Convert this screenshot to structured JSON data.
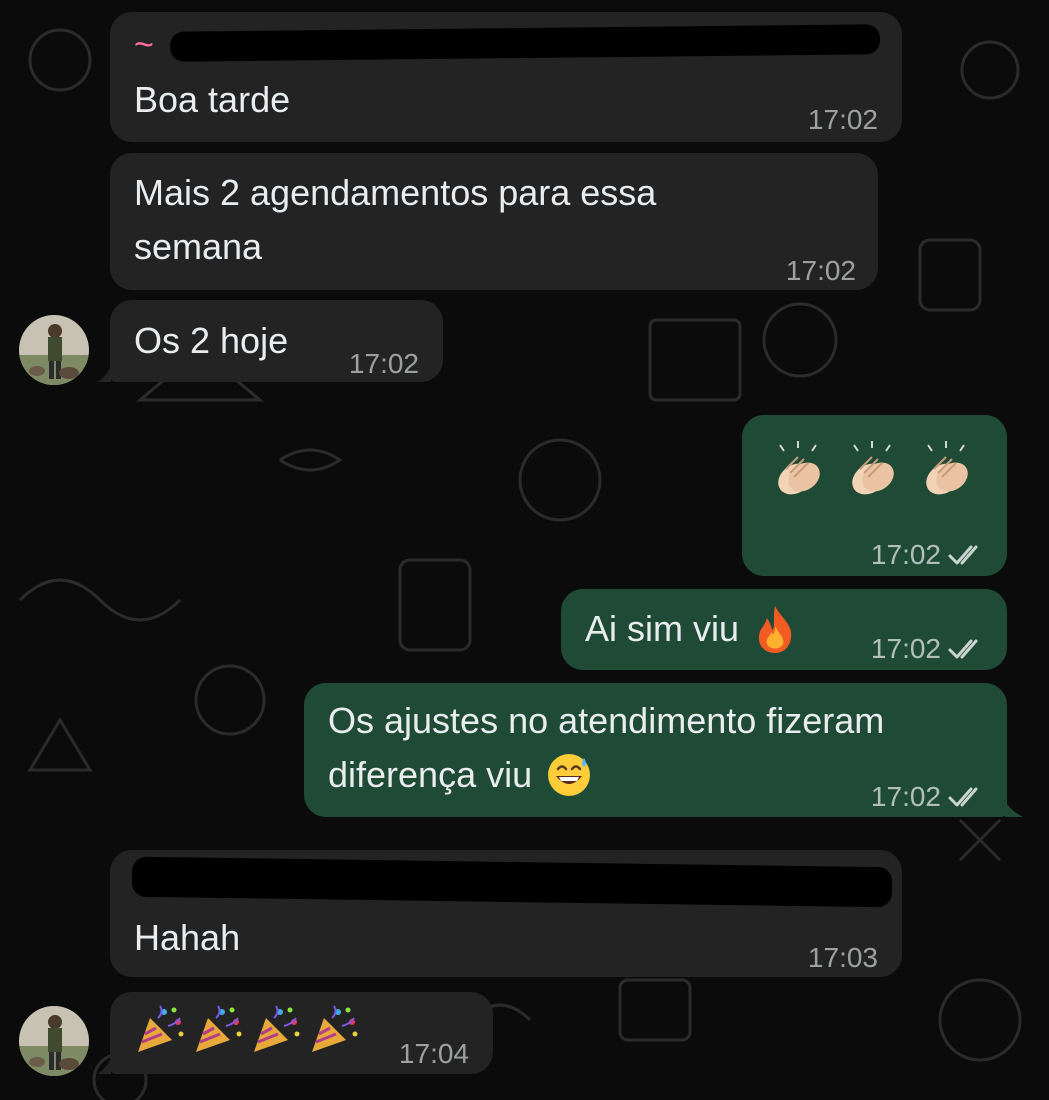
{
  "messages": [
    {
      "type": "incoming",
      "sender": "~",
      "text": "Boa tarde",
      "time": "17:02"
    },
    {
      "type": "incoming",
      "text_line1": "Mais 2 agendamentos para essa",
      "text_line2": "semana",
      "time": "17:02"
    },
    {
      "type": "incoming",
      "text": "Os 2 hoje",
      "time": "17:02"
    },
    {
      "type": "outgoing",
      "content": "clapping-hands-emoji x3",
      "time": "17:02",
      "status": "read"
    },
    {
      "type": "outgoing",
      "text": "Ai sim viu",
      "emoji": "fire-emoji",
      "time": "17:02",
      "status": "read"
    },
    {
      "type": "outgoing",
      "text_line1": "Os ajustes no atendimento fizeram",
      "text_line2": "diferença viu",
      "emoji": "grinning-sweat-emoji",
      "time": "17:02",
      "status": "read"
    },
    {
      "type": "incoming",
      "text": "Hahah",
      "time": "17:03"
    },
    {
      "type": "incoming",
      "content": "party-popper-emoji x4",
      "time": "17:04"
    }
  ],
  "colors": {
    "background": "#0b0b0b",
    "incoming_bubble": "#232323",
    "outgoing_bubble": "#1f4a35",
    "sender_name": "#ff6f9c",
    "read_ticks": "#c9d3cf"
  }
}
